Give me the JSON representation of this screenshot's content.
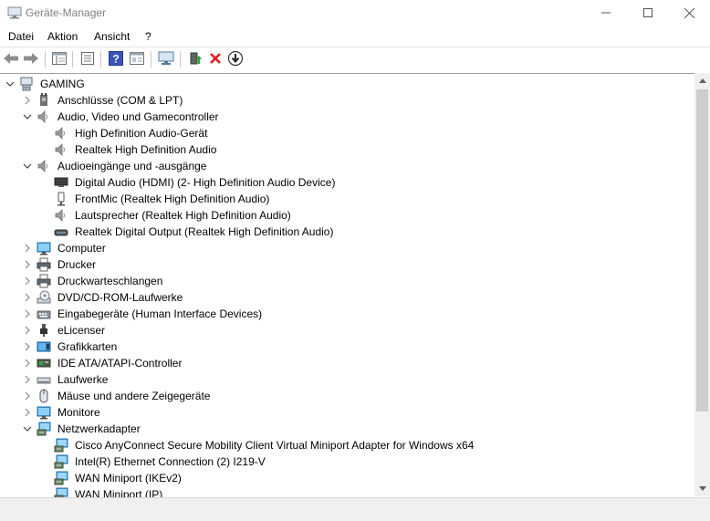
{
  "window": {
    "title": "Geräte-Manager"
  },
  "menu": [
    "Datei",
    "Aktion",
    "Ansicht",
    "?"
  ],
  "toolbar": [
    "back-icon",
    "forward-icon",
    "properties-pane-icon",
    "list-view-icon",
    "help-icon",
    "device-props-icon",
    "scan-hardware-icon",
    "update-driver-icon",
    "uninstall-icon",
    "disable-icon"
  ],
  "tree": [
    {
      "label": "GAMING",
      "level": 0,
      "expander": "expanded",
      "icon": "computer-root-icon"
    },
    {
      "label": "Anschlüsse (COM & LPT)",
      "level": 1,
      "expander": "collapsed",
      "icon": "port-icon"
    },
    {
      "label": "Audio, Video und Gamecontroller",
      "level": 1,
      "expander": "expanded",
      "icon": "speaker-icon"
    },
    {
      "label": "High Definition Audio-Gerät",
      "level": 2,
      "expander": "none",
      "icon": "speaker-icon"
    },
    {
      "label": "Realtek High Definition Audio",
      "level": 2,
      "expander": "none",
      "icon": "speaker-icon"
    },
    {
      "label": "Audioeingänge und -ausgänge",
      "level": 1,
      "expander": "expanded",
      "icon": "speaker-icon"
    },
    {
      "label": "Digital Audio (HDMI) (2- High Definition Audio Device)",
      "level": 2,
      "expander": "none",
      "icon": "monitor-dark-icon"
    },
    {
      "label": "FrontMic (Realtek High Definition Audio)",
      "level": 2,
      "expander": "none",
      "icon": "microphone-icon"
    },
    {
      "label": "Lautsprecher (Realtek High Definition Audio)",
      "level": 2,
      "expander": "none",
      "icon": "speaker-icon"
    },
    {
      "label": "Realtek Digital Output (Realtek High Definition Audio)",
      "level": 2,
      "expander": "none",
      "icon": "digital-output-icon"
    },
    {
      "label": "Computer",
      "level": 1,
      "expander": "collapsed",
      "icon": "monitor-icon"
    },
    {
      "label": "Drucker",
      "level": 1,
      "expander": "collapsed",
      "icon": "printer-icon"
    },
    {
      "label": "Druckwarteschlangen",
      "level": 1,
      "expander": "collapsed",
      "icon": "printer-icon"
    },
    {
      "label": "DVD/CD-ROM-Laufwerke",
      "level": 1,
      "expander": "collapsed",
      "icon": "dvd-drive-icon"
    },
    {
      "label": "Eingabegeräte (Human Interface Devices)",
      "level": 1,
      "expander": "collapsed",
      "icon": "hid-icon"
    },
    {
      "label": "eLicenser",
      "level": 1,
      "expander": "collapsed",
      "icon": "usb-icon"
    },
    {
      "label": "Grafikkarten",
      "level": 1,
      "expander": "collapsed",
      "icon": "display-adapter-icon"
    },
    {
      "label": "IDE ATA/ATAPI-Controller",
      "level": 1,
      "expander": "collapsed",
      "icon": "ide-controller-icon"
    },
    {
      "label": "Laufwerke",
      "level": 1,
      "expander": "collapsed",
      "icon": "disk-drive-icon"
    },
    {
      "label": "Mäuse und andere Zeigegeräte",
      "level": 1,
      "expander": "collapsed",
      "icon": "mouse-icon"
    },
    {
      "label": "Monitore",
      "level": 1,
      "expander": "collapsed",
      "icon": "monitor-icon"
    },
    {
      "label": "Netzwerkadapter",
      "level": 1,
      "expander": "expanded",
      "icon": "network-icon"
    },
    {
      "label": "Cisco AnyConnect Secure Mobility Client Virtual Miniport Adapter for Windows x64",
      "level": 2,
      "expander": "none",
      "icon": "network-icon"
    },
    {
      "label": "Intel(R) Ethernet Connection (2) I219-V",
      "level": 2,
      "expander": "none",
      "icon": "network-icon"
    },
    {
      "label": "WAN Miniport (IKEv2)",
      "level": 2,
      "expander": "none",
      "icon": "network-icon"
    },
    {
      "label": "WAN Miniport (IP)",
      "level": 2,
      "expander": "none",
      "icon": "network-icon"
    }
  ]
}
